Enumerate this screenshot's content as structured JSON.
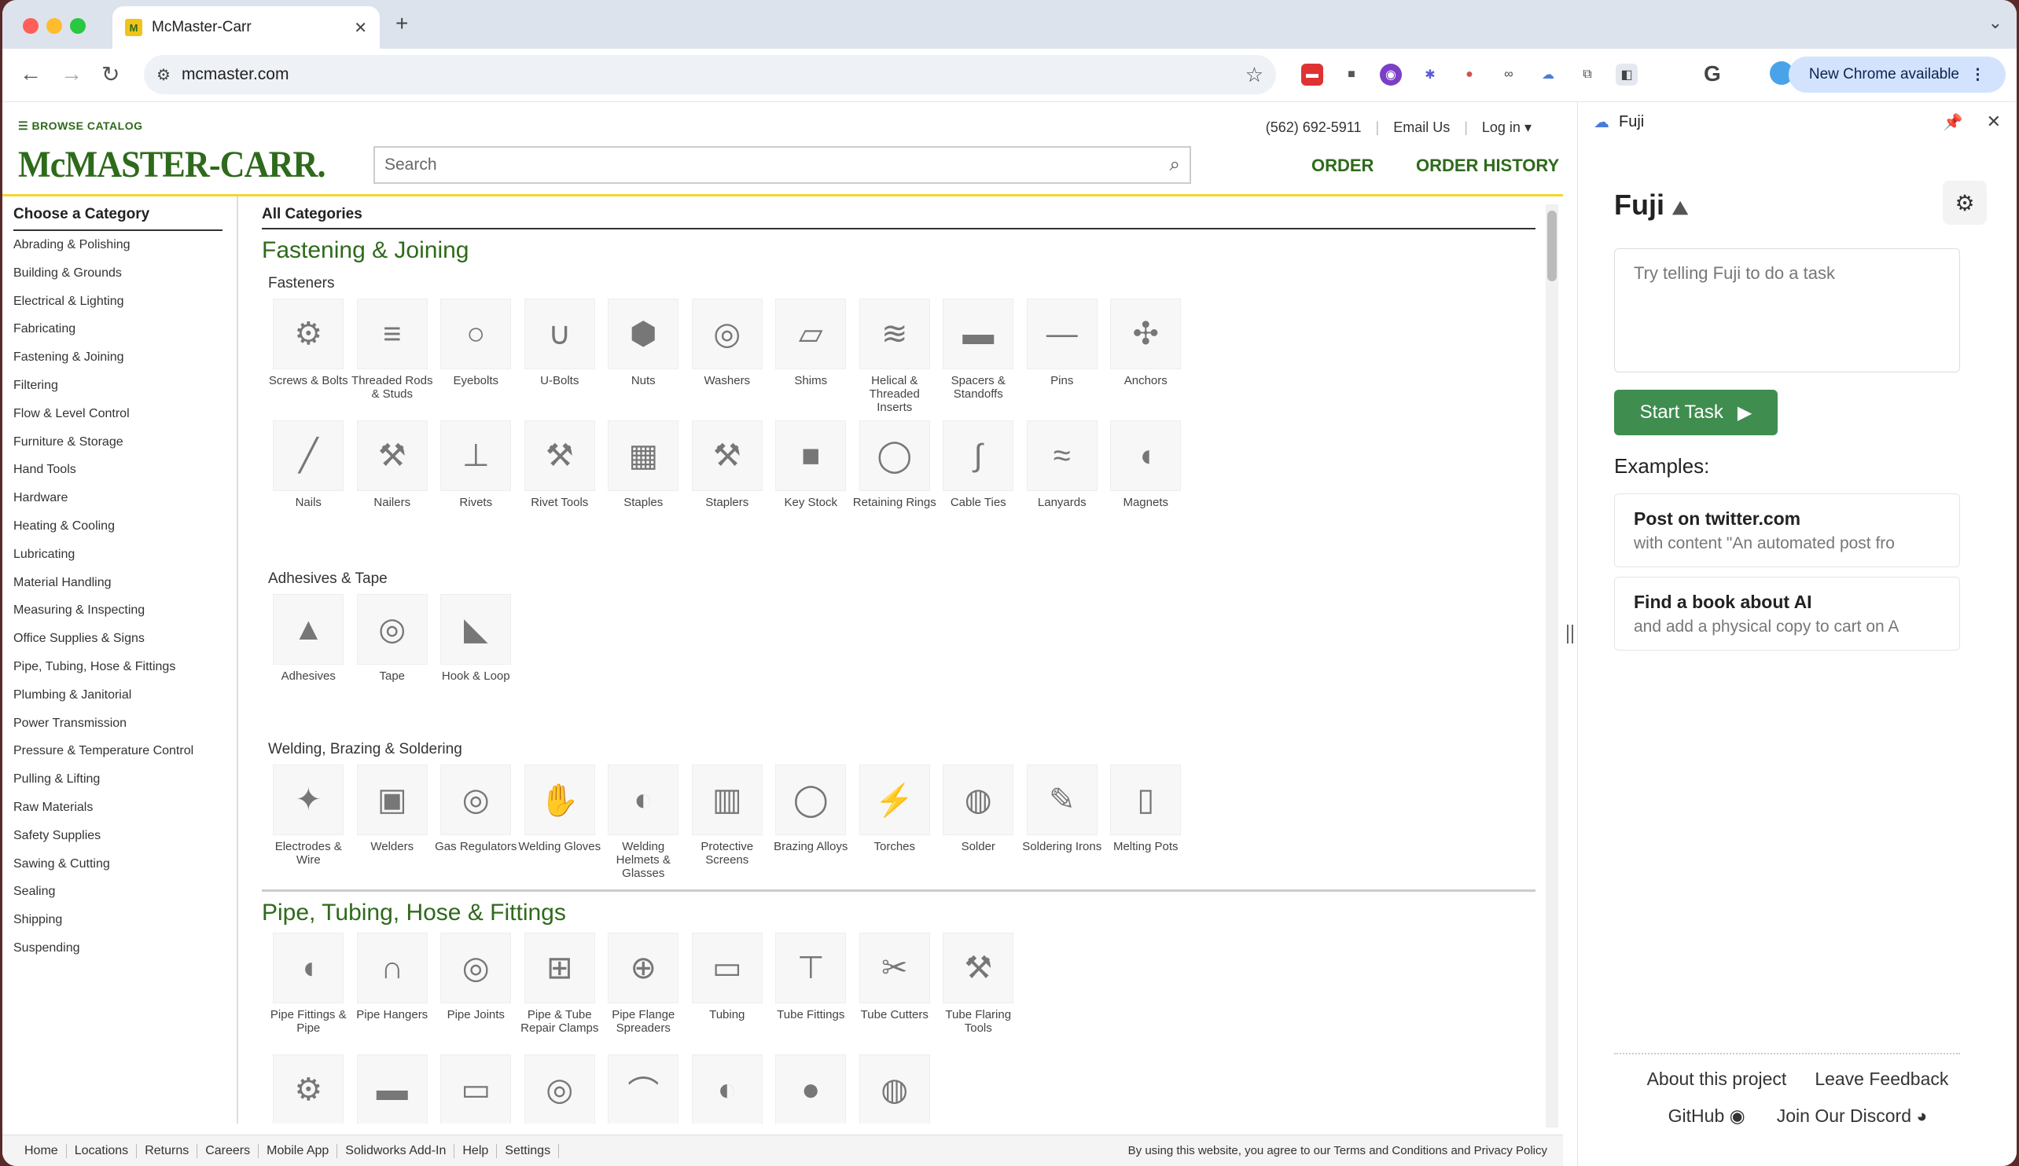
{
  "browser": {
    "tab_title": "McMaster-Carr",
    "favicon": "M",
    "url": "mcmaster.com",
    "update_label": "New Chrome available"
  },
  "header": {
    "browse": "BROWSE CATALOG",
    "logo": "McMASTER-CARR.",
    "search_placeholder": "Search",
    "phone": "(562) 692-5911",
    "email": "Email Us",
    "login": "Log in",
    "order": "ORDER",
    "order_history": "ORDER HISTORY"
  },
  "leftnav": {
    "title": "Choose a Category",
    "items": [
      "Abrading & Polishing",
      "Building & Grounds",
      "Electrical & Lighting",
      "Fabricating",
      "Fastening & Joining",
      "Filtering",
      "Flow & Level Control",
      "Furniture & Storage",
      "Hand Tools",
      "Hardware",
      "Heating & Cooling",
      "Lubricating",
      "Material Handling",
      "Measuring & Inspecting",
      "Office Supplies & Signs",
      "Pipe, Tubing, Hose & Fittings",
      "Plumbing & Janitorial",
      "Power Transmission",
      "Pressure & Temperature Control",
      "Pulling & Lifting",
      "Raw Materials",
      "Safety Supplies",
      "Sawing & Cutting",
      "Sealing",
      "Shipping",
      "Suspending"
    ]
  },
  "content": {
    "all_categories": "All Categories",
    "section1": {
      "title": "Fastening & Joining",
      "sub1": "Fasteners",
      "fasteners": [
        "Screws & Bolts",
        "Threaded Rods & Studs",
        "Eyebolts",
        "U-Bolts",
        "Nuts",
        "Washers",
        "Shims",
        "Helical & Threaded Inserts",
        "Spacers & Standoffs",
        "Pins",
        "Anchors",
        "Nails",
        "Nailers",
        "Rivets",
        "Rivet Tools",
        "Staples",
        "Staplers",
        "Key Stock",
        "Retaining Rings",
        "Cable Ties",
        "Lanyards",
        "Magnets"
      ],
      "sub2": "Adhesives & Tape",
      "adhesives": [
        "Adhesives",
        "Tape",
        "Hook & Loop"
      ],
      "sub3": "Welding, Brazing & Soldering",
      "welding": [
        "Electrodes & Wire",
        "Welders",
        "Gas Regulators",
        "Welding Gloves",
        "Welding Helmets & Glasses",
        "Protective Screens",
        "Brazing Alloys",
        "Torches",
        "Solder",
        "Soldering Irons",
        "Melting Pots"
      ]
    },
    "section2": {
      "title": "Pipe, Tubing, Hose & Fittings",
      "items": [
        "Pipe Fittings & Pipe",
        "Pipe Hangers",
        "Pipe Joints",
        "Pipe & Tube Repair Clamps",
        "Pipe Flange Spreaders",
        "Tubing",
        "Tube Fittings",
        "Tube Cutters",
        "Tube Flaring Tools"
      ]
    }
  },
  "footer": {
    "links": [
      "Home",
      "Locations",
      "Returns",
      "Careers",
      "Mobile App",
      "Solidworks Add-In",
      "Help",
      "Settings"
    ],
    "legal": "By using this website, you agree to our Terms and Conditions and Privacy Policy"
  },
  "sidepanel": {
    "header": "Fuji",
    "title": "Fuji",
    "task_placeholder": "Try telling Fuji to do a task",
    "start": "Start Task",
    "examples_label": "Examples:",
    "examples": [
      {
        "title": "Post on twitter.com",
        "sub": "with content \"An automated post fro"
      },
      {
        "title": "Find a book about AI",
        "sub": "and add a physical copy to cart on A"
      }
    ],
    "about": "About this project",
    "feedback": "Leave Feedback",
    "github": "GitHub",
    "discord": "Join Our Discord"
  },
  "colors": {
    "brand_green": "#2e6a1b",
    "brand_yellow": "#f2d730",
    "fuji_button": "#3f8d4f"
  }
}
